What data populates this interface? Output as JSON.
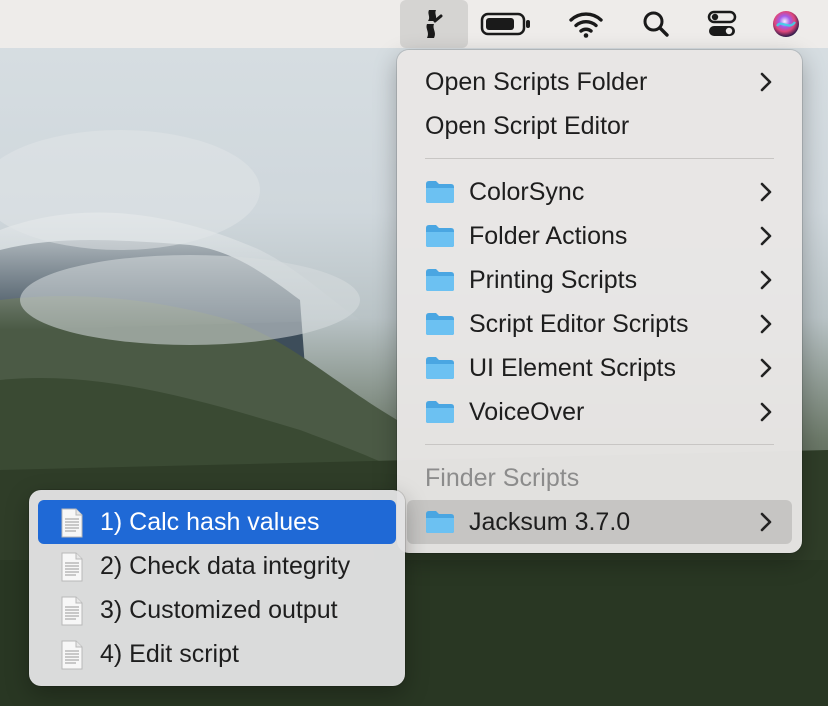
{
  "menubar": {
    "icons": [
      "script-menu-icon",
      "battery-icon",
      "wifi-icon",
      "spotlight-search-icon",
      "control-center-icon",
      "siri-icon"
    ]
  },
  "script_menu": {
    "items": [
      {
        "label": "Open Scripts Folder",
        "has_submenu": true
      },
      {
        "label": "Open Script Editor",
        "has_submenu": false
      }
    ],
    "folders": [
      {
        "label": "ColorSync"
      },
      {
        "label": "Folder Actions"
      },
      {
        "label": "Printing Scripts"
      },
      {
        "label": "Script Editor Scripts"
      },
      {
        "label": "UI Element Scripts"
      },
      {
        "label": "VoiceOver"
      }
    ],
    "section_header": "Finder Scripts",
    "section_items": [
      {
        "label": "Jacksum 3.7.0",
        "highlighted": true
      }
    ]
  },
  "submenu": {
    "items": [
      {
        "label": "1) Calc hash values",
        "selected": true
      },
      {
        "label": "2) Check data integrity",
        "selected": false
      },
      {
        "label": "3) Customized output",
        "selected": false
      },
      {
        "label": "4) Edit script",
        "selected": false
      }
    ]
  },
  "colors": {
    "accent": "#1f69d6",
    "folder": "#5bb4ec",
    "menu_bg": "#e8e6e5"
  }
}
